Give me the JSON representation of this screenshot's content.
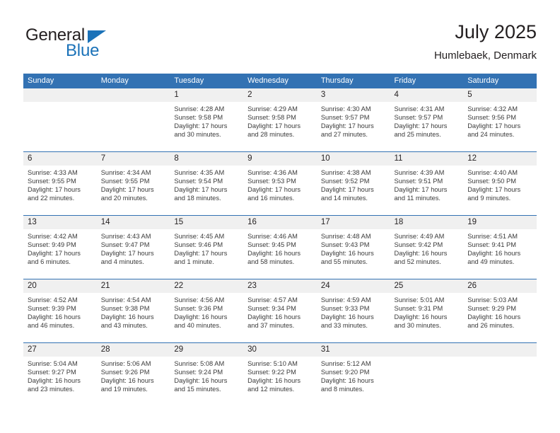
{
  "logo": {
    "word_top": "General",
    "word_bottom": "Blue",
    "triangle_color": "#1b72b8",
    "text_color": "#231f20"
  },
  "header": {
    "month_title": "July 2025",
    "location": "Humlebaek, Denmark"
  },
  "theme": {
    "header_blue": "#3372b3",
    "daynum_band": "#f0f0f0",
    "cell_background": "#ffffff",
    "text": "#231f20"
  },
  "calendar": {
    "weekday_headers": [
      "Sunday",
      "Monday",
      "Tuesday",
      "Wednesday",
      "Thursday",
      "Friday",
      "Saturday"
    ],
    "weeks": [
      [
        {
          "day": "",
          "lines": []
        },
        {
          "day": "",
          "lines": []
        },
        {
          "day": "1",
          "lines": [
            "Sunrise: 4:28 AM",
            "Sunset: 9:58 PM",
            "Daylight: 17 hours",
            "and 30 minutes."
          ]
        },
        {
          "day": "2",
          "lines": [
            "Sunrise: 4:29 AM",
            "Sunset: 9:58 PM",
            "Daylight: 17 hours",
            "and 28 minutes."
          ]
        },
        {
          "day": "3",
          "lines": [
            "Sunrise: 4:30 AM",
            "Sunset: 9:57 PM",
            "Daylight: 17 hours",
            "and 27 minutes."
          ]
        },
        {
          "day": "4",
          "lines": [
            "Sunrise: 4:31 AM",
            "Sunset: 9:57 PM",
            "Daylight: 17 hours",
            "and 25 minutes."
          ]
        },
        {
          "day": "5",
          "lines": [
            "Sunrise: 4:32 AM",
            "Sunset: 9:56 PM",
            "Daylight: 17 hours",
            "and 24 minutes."
          ]
        }
      ],
      [
        {
          "day": "6",
          "lines": [
            "Sunrise: 4:33 AM",
            "Sunset: 9:55 PM",
            "Daylight: 17 hours",
            "and 22 minutes."
          ]
        },
        {
          "day": "7",
          "lines": [
            "Sunrise: 4:34 AM",
            "Sunset: 9:55 PM",
            "Daylight: 17 hours",
            "and 20 minutes."
          ]
        },
        {
          "day": "8",
          "lines": [
            "Sunrise: 4:35 AM",
            "Sunset: 9:54 PM",
            "Daylight: 17 hours",
            "and 18 minutes."
          ]
        },
        {
          "day": "9",
          "lines": [
            "Sunrise: 4:36 AM",
            "Sunset: 9:53 PM",
            "Daylight: 17 hours",
            "and 16 minutes."
          ]
        },
        {
          "day": "10",
          "lines": [
            "Sunrise: 4:38 AM",
            "Sunset: 9:52 PM",
            "Daylight: 17 hours",
            "and 14 minutes."
          ]
        },
        {
          "day": "11",
          "lines": [
            "Sunrise: 4:39 AM",
            "Sunset: 9:51 PM",
            "Daylight: 17 hours",
            "and 11 minutes."
          ]
        },
        {
          "day": "12",
          "lines": [
            "Sunrise: 4:40 AM",
            "Sunset: 9:50 PM",
            "Daylight: 17 hours",
            "and 9 minutes."
          ]
        }
      ],
      [
        {
          "day": "13",
          "lines": [
            "Sunrise: 4:42 AM",
            "Sunset: 9:49 PM",
            "Daylight: 17 hours",
            "and 6 minutes."
          ]
        },
        {
          "day": "14",
          "lines": [
            "Sunrise: 4:43 AM",
            "Sunset: 9:47 PM",
            "Daylight: 17 hours",
            "and 4 minutes."
          ]
        },
        {
          "day": "15",
          "lines": [
            "Sunrise: 4:45 AM",
            "Sunset: 9:46 PM",
            "Daylight: 17 hours",
            "and 1 minute."
          ]
        },
        {
          "day": "16",
          "lines": [
            "Sunrise: 4:46 AM",
            "Sunset: 9:45 PM",
            "Daylight: 16 hours",
            "and 58 minutes."
          ]
        },
        {
          "day": "17",
          "lines": [
            "Sunrise: 4:48 AM",
            "Sunset: 9:43 PM",
            "Daylight: 16 hours",
            "and 55 minutes."
          ]
        },
        {
          "day": "18",
          "lines": [
            "Sunrise: 4:49 AM",
            "Sunset: 9:42 PM",
            "Daylight: 16 hours",
            "and 52 minutes."
          ]
        },
        {
          "day": "19",
          "lines": [
            "Sunrise: 4:51 AM",
            "Sunset: 9:41 PM",
            "Daylight: 16 hours",
            "and 49 minutes."
          ]
        }
      ],
      [
        {
          "day": "20",
          "lines": [
            "Sunrise: 4:52 AM",
            "Sunset: 9:39 PM",
            "Daylight: 16 hours",
            "and 46 minutes."
          ]
        },
        {
          "day": "21",
          "lines": [
            "Sunrise: 4:54 AM",
            "Sunset: 9:38 PM",
            "Daylight: 16 hours",
            "and 43 minutes."
          ]
        },
        {
          "day": "22",
          "lines": [
            "Sunrise: 4:56 AM",
            "Sunset: 9:36 PM",
            "Daylight: 16 hours",
            "and 40 minutes."
          ]
        },
        {
          "day": "23",
          "lines": [
            "Sunrise: 4:57 AM",
            "Sunset: 9:34 PM",
            "Daylight: 16 hours",
            "and 37 minutes."
          ]
        },
        {
          "day": "24",
          "lines": [
            "Sunrise: 4:59 AM",
            "Sunset: 9:33 PM",
            "Daylight: 16 hours",
            "and 33 minutes."
          ]
        },
        {
          "day": "25",
          "lines": [
            "Sunrise: 5:01 AM",
            "Sunset: 9:31 PM",
            "Daylight: 16 hours",
            "and 30 minutes."
          ]
        },
        {
          "day": "26",
          "lines": [
            "Sunrise: 5:03 AM",
            "Sunset: 9:29 PM",
            "Daylight: 16 hours",
            "and 26 minutes."
          ]
        }
      ],
      [
        {
          "day": "27",
          "lines": [
            "Sunrise: 5:04 AM",
            "Sunset: 9:27 PM",
            "Daylight: 16 hours",
            "and 23 minutes."
          ]
        },
        {
          "day": "28",
          "lines": [
            "Sunrise: 5:06 AM",
            "Sunset: 9:26 PM",
            "Daylight: 16 hours",
            "and 19 minutes."
          ]
        },
        {
          "day": "29",
          "lines": [
            "Sunrise: 5:08 AM",
            "Sunset: 9:24 PM",
            "Daylight: 16 hours",
            "and 15 minutes."
          ]
        },
        {
          "day": "30",
          "lines": [
            "Sunrise: 5:10 AM",
            "Sunset: 9:22 PM",
            "Daylight: 16 hours",
            "and 12 minutes."
          ]
        },
        {
          "day": "31",
          "lines": [
            "Sunrise: 5:12 AM",
            "Sunset: 9:20 PM",
            "Daylight: 16 hours",
            "and 8 minutes."
          ]
        },
        {
          "day": "",
          "lines": []
        },
        {
          "day": "",
          "lines": []
        }
      ]
    ]
  }
}
